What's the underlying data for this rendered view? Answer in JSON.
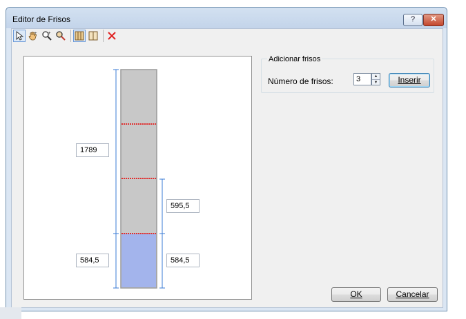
{
  "window": {
    "title": "Editor de Frisos",
    "help_label": "?",
    "close_label": "✕"
  },
  "toolbar": {
    "tools": [
      {
        "name": "pointer-tool-icon",
        "active": true
      },
      {
        "name": "pan-hand-tool-icon"
      },
      {
        "name": "zoom-in-tool-icon"
      },
      {
        "name": "zoom-tool-icon"
      },
      {
        "name": "horizontal-frieze-tool-icon",
        "active": true
      },
      {
        "name": "vertical-frieze-tool-icon"
      },
      {
        "name": "delete-tool-icon"
      }
    ]
  },
  "drawing": {
    "total_height": "1789",
    "segment_right": "595,5",
    "bottom_right": "584,5",
    "bottom_left": "584,5",
    "panel_fill": "#c8c8c8",
    "frieze_fill": "#a3b4ec",
    "dimension_color": "#3a7bd5",
    "frieze_line_color": "#e03030"
  },
  "insert_group": {
    "title": "Adicionar frisos",
    "count_label": "Número de frisos:",
    "count_value": "3",
    "insert_button": "Inserir"
  },
  "footer": {
    "ok_label": "OK",
    "cancel_label": "Cancelar"
  }
}
